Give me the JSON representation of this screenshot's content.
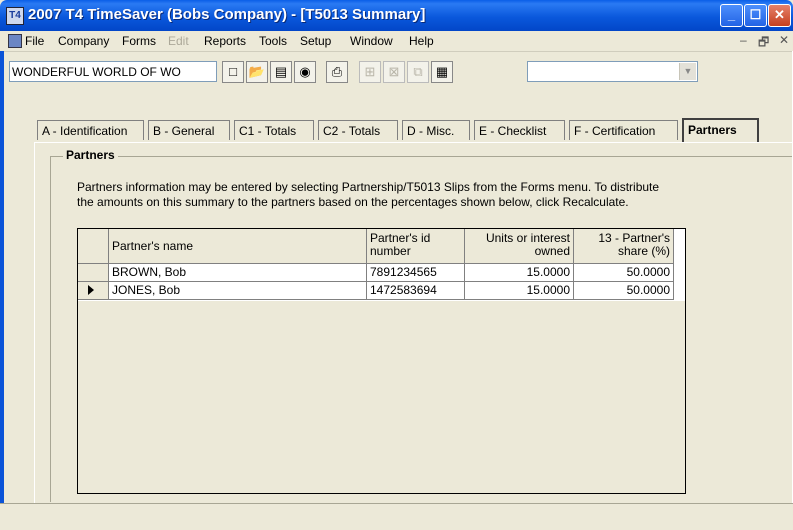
{
  "window": {
    "title": "2007 T4 TimeSaver (Bobs Company) - [T5013 Summary]",
    "app_icon": "T4",
    "minimize": "_",
    "maximize": "☐",
    "close": "✕"
  },
  "menu": {
    "items": [
      "File",
      "Company",
      "Forms",
      "Edit",
      "Reports",
      "Tools",
      "Setup",
      "Window",
      "Help"
    ],
    "disabled": [
      "Edit"
    ],
    "mdi_minimize": "–",
    "mdi_restore": "🗗",
    "mdi_close": "✕"
  },
  "toolbar": {
    "company_name": "WONDERFUL WORLD OF WO",
    "icons": [
      "new-icon",
      "open-icon",
      "document-icon",
      "find-icon",
      "print-icon",
      "add-slip-icon",
      "delete-slip-icon",
      "copy-slip-icon",
      "calculator-icon"
    ],
    "combo_value": ""
  },
  "tabs": [
    {
      "label": "A - Identification",
      "active": false
    },
    {
      "label": "B - General",
      "active": false
    },
    {
      "label": "C1 - Totals",
      "active": false
    },
    {
      "label": "C2 - Totals",
      "active": false
    },
    {
      "label": "D - Misc.",
      "active": false
    },
    {
      "label": "E - Checklist",
      "active": false
    },
    {
      "label": "F - Certification",
      "active": false
    },
    {
      "label": "Partners",
      "active": true
    }
  ],
  "partners": {
    "group_title": "Partners",
    "info_line1": "Partners information may be entered by selecting Partnership/T5013 Slips from the Forms menu.  To distribute",
    "info_line2": "the amounts on this summary to the partners based on the percentages shown below, click Recalculate.",
    "columns": [
      {
        "line1": "Partner's name",
        "line2": ""
      },
      {
        "line1": "Partner's id",
        "line2": "number"
      },
      {
        "line1": "Units or interest",
        "line2": "owned"
      },
      {
        "line1": "13 - Partner's",
        "line2": "share (%)"
      }
    ],
    "rows": [
      {
        "name": "BROWN, Bob",
        "id": "7891234565",
        "units": "15.0000",
        "share": "50.0000",
        "current": false
      },
      {
        "name": "JONES, Bob",
        "id": "1472583694",
        "units": "15.0000",
        "share": "50.0000",
        "current": true
      }
    ]
  },
  "colors": {
    "titlebar": "#0a58dc",
    "face": "#ece9d8"
  }
}
